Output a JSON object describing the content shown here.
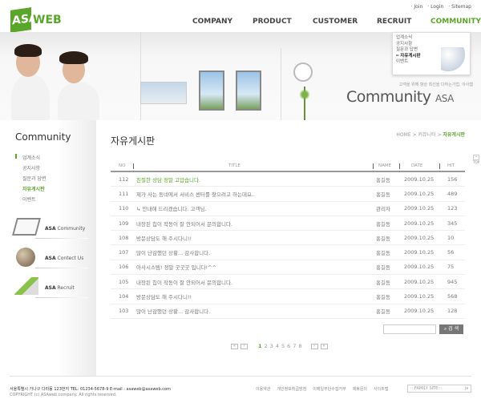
{
  "header": {
    "logo": {
      "mark": "ASA",
      "text": "WEB"
    },
    "util_links": [
      "Join",
      "Login",
      "Sitemap"
    ],
    "nav": [
      "COMPANY",
      "PRODUCT",
      "CUSTOMER",
      "RECRUIT",
      "COMMUNITY"
    ],
    "submenu": [
      "업계소식",
      "공지사항",
      "질문과 답변",
      "자유게시판",
      "이벤트"
    ]
  },
  "banner": {
    "slogan": "고객을 위해 항상 최선을 다하는기업, 아사웹",
    "title": "Community",
    "title_suffix": "ASA"
  },
  "sidebar": {
    "title": "Community",
    "items": [
      "업계소식",
      "공지사항",
      "질문과 답변",
      "자유게시판",
      "이벤트"
    ],
    "banners": [
      {
        "bold": "ASA",
        "label": "Community"
      },
      {
        "bold": "ASA",
        "label": "Contect Us"
      },
      {
        "bold": "ASA",
        "label": "Recruit"
      }
    ]
  },
  "main": {
    "title": "자유게시판",
    "breadcrumb": [
      "HOME",
      "커뮤니티",
      "자유게시판"
    ],
    "columns": [
      "NO",
      "TITLE",
      "NAME",
      "DATE",
      "HIT"
    ],
    "rows": [
      {
        "no": "112",
        "title": "친절한 상담 정말 고맙습니다.",
        "name": "홍길동",
        "date": "2009.10.25",
        "hit": "156"
      },
      {
        "no": "111",
        "title": "제가 사는 동네에서 서비스 센터를 찾으려고 하는데요..",
        "name": "홍길동",
        "date": "2009.10.25",
        "hit": "489"
      },
      {
        "no": "110",
        "title": "↳ 안내해 드리겠습니다. 고객님.",
        "name": "관리자",
        "date": "2009.10.25",
        "hit": "123"
      },
      {
        "no": "109",
        "title": "내장된 칩이 작동이 잘 안되어서 문의합니다.",
        "name": "홍길동",
        "date": "2009.10.25",
        "hit": "345"
      },
      {
        "no": "108",
        "title": "방문상담도 해 주시다니!!",
        "name": "홍길동",
        "date": "2009.10.25",
        "hit": "10"
      },
      {
        "no": "107",
        "title": "많이 난감했던 상황... 감사합니다.",
        "name": "홍길동",
        "date": "2009.10.25",
        "hit": "56"
      },
      {
        "no": "106",
        "title": "아사시스템! 정말 굿굿굿 입니다!^^",
        "name": "홍길동",
        "date": "2009.10.25",
        "hit": "75"
      },
      {
        "no": "105",
        "title": "내장된 칩이 작동이 잘 안되어서 문의합니다.",
        "name": "홍길동",
        "date": "2009.10.25",
        "hit": "945"
      },
      {
        "no": "104",
        "title": "방문상담도 해 주시다니!!",
        "name": "홍길동",
        "date": "2009.10.25",
        "hit": "568"
      },
      {
        "no": "103",
        "title": "많이 난감했던 상황... 감사합니다.",
        "name": "홍길동",
        "date": "2009.10.25",
        "hit": "128"
      }
    ],
    "search": {
      "value": "",
      "button": "검 색"
    },
    "pagination": {
      "first": "«",
      "prev": "‹",
      "pages": [
        "1",
        "2",
        "3",
        "4",
        "5",
        "6",
        "7",
        "8"
      ],
      "current": "1",
      "next": "›",
      "last": "»"
    },
    "top": "TOP"
  },
  "footer": {
    "address": "서울특별시 가나구 다라동 123번지  TEL: 01234-5678-9   E-mail : asaweb@asaweb.com",
    "copyright": "COPYRIGHT (c) ASAweb company. All rights reserved.",
    "links": [
      "이용약관",
      "개인정보취급방침",
      "이메일무단수집거부",
      "제휴문의",
      "사이트맵"
    ],
    "family_site": ":::FAMILY SITE:::"
  },
  "colors": {
    "accent": "#5aa62a"
  }
}
